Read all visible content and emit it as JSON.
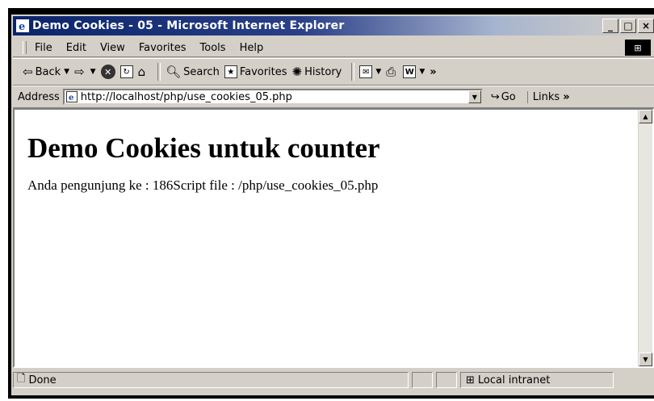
{
  "window": {
    "title": "Demo Cookies - 05 - Microsoft Internet Explorer",
    "min": "_",
    "max": "□",
    "close": "×"
  },
  "menu": {
    "items": [
      "File",
      "Edit",
      "View",
      "Favorites",
      "Tools",
      "Help"
    ]
  },
  "toolbar": {
    "back": "Back",
    "search": "Search",
    "favorites": "Favorites",
    "history": "History"
  },
  "address": {
    "label": "Address",
    "url": "http://localhost/php/use_cookies_05.php",
    "go": "Go",
    "links": "Links"
  },
  "page": {
    "heading": "Demo Cookies untuk counter",
    "body": "Anda pengunjung ke : 186Script file : /php/use_cookies_05.php"
  },
  "status": {
    "text": "Done",
    "zone": "Local intranet"
  }
}
